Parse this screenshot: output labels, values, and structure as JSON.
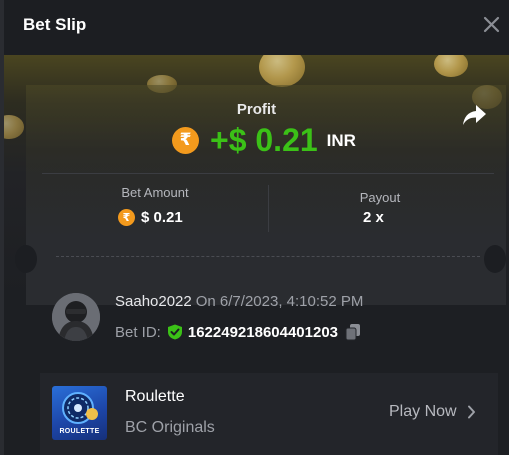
{
  "header": {
    "title": "Bet Slip",
    "close_icon": "close-icon"
  },
  "profit": {
    "label": "Profit",
    "currency_symbol": "₹",
    "amount": "+$ 0.21",
    "currency": "INR",
    "share_icon": "share-icon",
    "color": "#3bc117"
  },
  "bet_amount": {
    "label": "Bet Amount",
    "currency_symbol": "₹",
    "value": "$ 0.21"
  },
  "payout": {
    "label": "Payout",
    "value": "2 x"
  },
  "user": {
    "username": "Saaho2022",
    "datetime": "On 6/7/2023, 4:10:52 PM",
    "bet_id_label": "Bet ID:",
    "bet_id": "162249218604401203",
    "verified_icon": "shield-check-icon",
    "copy_icon": "copy-icon"
  },
  "game": {
    "name": "Roulette",
    "provider": "BC Originals",
    "thumb_text": "ROULETTE",
    "play_label": "Play Now",
    "chevron_icon": "chevron-right-icon"
  },
  "colors": {
    "background": "#1c1e22",
    "accent_orange": "#f39a1d",
    "profit_green": "#3bc117"
  }
}
